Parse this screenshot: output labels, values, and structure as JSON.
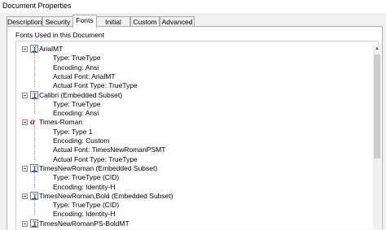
{
  "window": {
    "title": "Document Properties"
  },
  "tabs": [
    {
      "label": "Description"
    },
    {
      "label": "Security"
    },
    {
      "label": "Fonts"
    },
    {
      "label": "Initial View"
    },
    {
      "label": "Custom"
    },
    {
      "label": "Advanced"
    }
  ],
  "group": {
    "label": "Fonts Used in this Document"
  },
  "fonts": [
    {
      "name": "ArialMT",
      "icon": "truetype-font-icon",
      "props": [
        "Type: TrueType",
        "Encoding: Ansi",
        "Actual Font: ArialMT",
        "Actual Font Type: TrueType"
      ]
    },
    {
      "name": "Calibri (Embedded Subset)",
      "icon": "truetype-font-icon",
      "props": [
        "Type: TrueType",
        "Encoding: Ansi"
      ]
    },
    {
      "name": "Times-Roman",
      "icon": "type1-font-icon",
      "props": [
        "Type: Type 1",
        "Encoding: Custom",
        "Actual Font: TimesNewRomanPSMT",
        "Actual Font Type: TrueType"
      ]
    },
    {
      "name": "TimesNewRoman (Embedded Subset)",
      "icon": "truetype-font-icon",
      "props": [
        "Type: TrueType (CID)",
        "Encoding: Identity-H"
      ]
    },
    {
      "name": "TimesNewRoman,Bold (Embedded Subset)",
      "icon": "truetype-font-icon",
      "props": [
        "Type: TrueType (CID)",
        "Encoding: Identity-H"
      ]
    },
    {
      "name": "TimesNewRomanPS-BoldMT",
      "icon": "truetype-font-icon",
      "props": []
    }
  ]
}
